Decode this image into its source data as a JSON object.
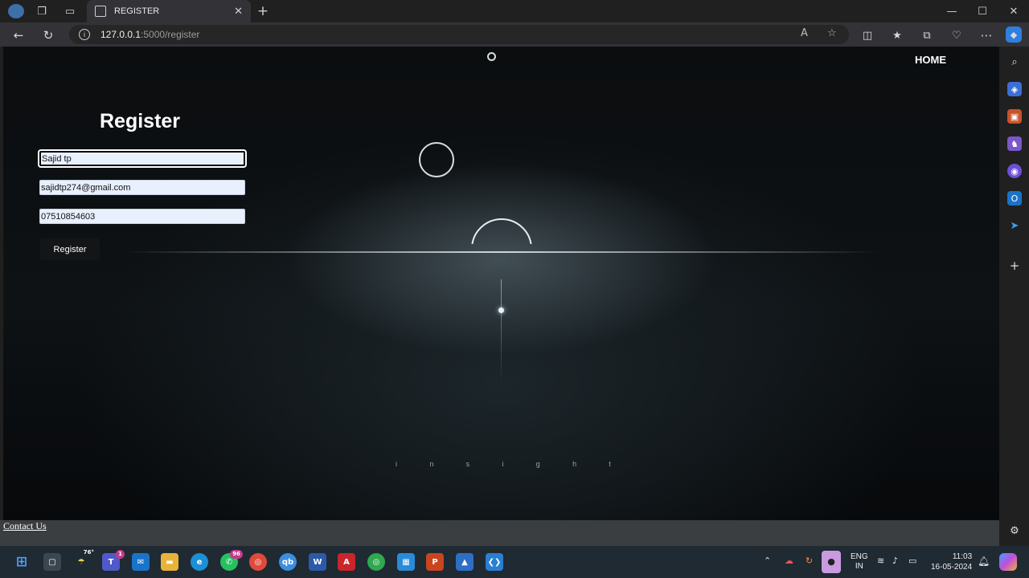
{
  "browser": {
    "tab_title": "REGISTER",
    "tab_close": "✕",
    "new_tab": "+",
    "address_host": "127.0.0.1",
    "address_path": ":5000/register",
    "window_controls": {
      "minimize": "—",
      "maximize": "☐",
      "close": "✕"
    },
    "nav": {
      "back": "←",
      "reload": "↻",
      "more": "⋯"
    }
  },
  "page": {
    "nav_home": "HOME",
    "heading": "Register",
    "form": {
      "name_value": "Sajid tp",
      "email_value": "sajidtp274@gmail.com",
      "phone_value": "07510854603",
      "submit_label": "Register"
    },
    "footer_link": "Contact Us"
  },
  "taskbar": {
    "weather": "76°",
    "teams_badge": "1",
    "whatsapp_badge": "96",
    "language_line1": "ENG",
    "language_line2": "IN",
    "time": "11:03",
    "date": "16-05-2024"
  },
  "colors": {
    "page_bg": "#0b0d0f",
    "input_bg": "#e8f0fe",
    "footer_bg": "#3a3e40",
    "taskbar_bg": "#1f2a33"
  }
}
